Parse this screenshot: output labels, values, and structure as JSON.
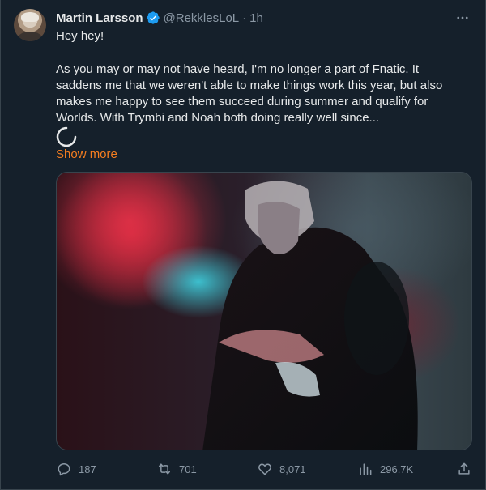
{
  "author": {
    "name": "Martin Larsson",
    "handle": "@RekklesLoL",
    "separator": "·",
    "time": "1h"
  },
  "tweet": {
    "paragraph_1": "Hey hey!",
    "paragraph_2": "As you may or may not have heard, I'm no longer a part of Fnatic. It saddens me that we weren't able to make things work this year, but also makes me happy to see them succeed during summer and qualify for Worlds. With Trymbi and Noah both doing really well since...",
    "show_more": "Show more"
  },
  "actions": {
    "replies": "187",
    "retweets": "701",
    "likes": "8,071",
    "views": "296.7K"
  },
  "icons": {
    "verified": "verified-badge-icon",
    "more": "more-horizontal-icon",
    "reply": "reply-icon",
    "retweet": "retweet-icon",
    "like": "heart-icon",
    "views": "views-chart-icon",
    "share": "share-icon",
    "loading": "loading-spinner-icon"
  },
  "colors": {
    "background": "#15202b",
    "text": "#e7e9ea",
    "muted": "#8b98a5",
    "accent_link": "#f47d20",
    "verified": "#1d9bf0"
  }
}
